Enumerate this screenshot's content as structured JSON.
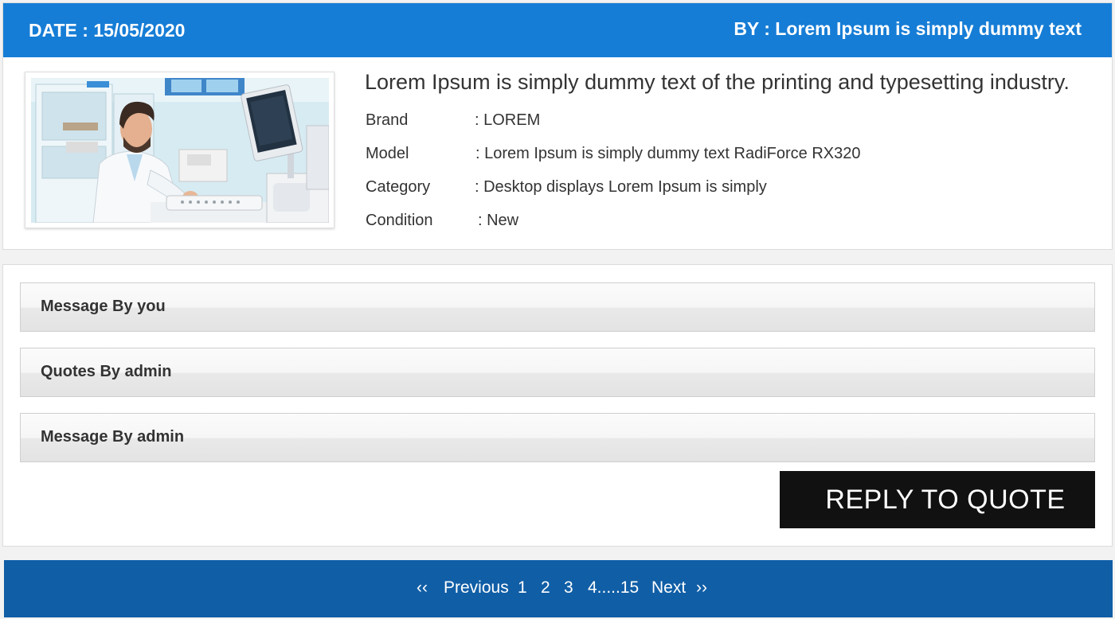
{
  "header": {
    "date_text": "DATE :  15/05/2020",
    "by_text": "BY : Lorem Ipsum is simply dummy text"
  },
  "product": {
    "title": "Lorem Ipsum is simply dummy text of the printing and typesetting industry.",
    "specs": [
      {
        "label": "Brand",
        "value": ":  LOREM"
      },
      {
        "label": "Model",
        "value": ":  Lorem Ipsum is simply dummy text RadiForce RX320"
      },
      {
        "label": "Category",
        "value": ":  Desktop displays Lorem Ipsum is simply"
      },
      {
        "label": "Condition",
        "value": ":  New"
      }
    ]
  },
  "messages": {
    "sections": [
      {
        "label": "Message By you"
      },
      {
        "label": "Quotes By admin"
      },
      {
        "label": "Message By admin"
      }
    ],
    "reply_label": "REPLY TO QUOTE"
  },
  "pagination": {
    "first": "‹‹",
    "previous": "Previous",
    "pages": [
      "1",
      "2",
      "3",
      "4.....15"
    ],
    "next": "Next",
    "last": "››"
  },
  "colors": {
    "header_bg": "#167dd6",
    "pager_bg": "#105ea6",
    "button_bg": "#111111"
  }
}
